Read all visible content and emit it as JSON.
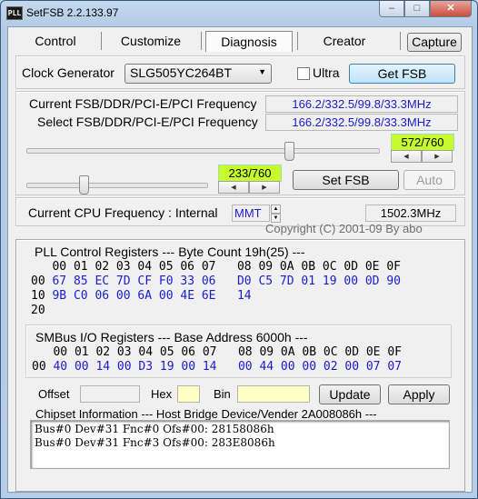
{
  "window": {
    "title": "SetFSB 2.2.133.97",
    "icon_text": "PLL"
  },
  "tabs": [
    {
      "label": "Control"
    },
    {
      "label": "Customize"
    },
    {
      "label": "Diagnosis"
    },
    {
      "label": "Creator"
    }
  ],
  "capture_button": "Capture",
  "clock_generator": {
    "label": "Clock Generator",
    "value": "SLG505YC264BT",
    "ultra_label": "Ultra",
    "ultra_checked": false,
    "get_fsb_button": "Get FSB"
  },
  "freq": {
    "current_label": "Current FSB/DDR/PCI-E/PCI Frequency",
    "current_value": "166.2/332.5/99.8/33.3MHz",
    "select_label": "Select FSB/DDR/PCI-E/PCI Frequency",
    "select_value": "166.2/332.5/99.8/33.3MHz"
  },
  "slider_main": {
    "readout": "572/760",
    "value": 572,
    "max": 760
  },
  "slider_small": {
    "readout": "233/760",
    "value": 233,
    "max": 760
  },
  "set_fsb_button": "Set FSB",
  "auto_button": "Auto",
  "cpu": {
    "label": "Current CPU Frequency : Internal",
    "mode": "MMT",
    "value": "1502.3MHz"
  },
  "copyright": "Copyright (C) 2001-09 By abo",
  "pll": {
    "title": "PLL Control Registers  --- Byte Count 19h(25) ---",
    "header": "   00 01 02 03 04 05 06 07   08 09 0A 0B 0C 0D 0E 0F",
    "rows": [
      {
        "idx": "00",
        "data": " 67 85 EC 7D CF F0 33 06   D0 C5 7D 01 19 00 0D 90"
      },
      {
        "idx": "10",
        "data": " 9B C0 06 00 6A 00 4E 6E   14"
      },
      {
        "idx": "20",
        "data": ""
      }
    ]
  },
  "smbus": {
    "title": "SMBus I/O Registers  --- Base Address 6000h ---",
    "header": "   00 01 02 03 04 05 06 07   08 09 0A 0B 0C 0D 0E 0F",
    "rows": [
      {
        "idx": "00",
        "data": " 40 00 14 00 D3 19 00 14   00 44 00 00 02 00 07 07"
      }
    ]
  },
  "io": {
    "offset_label": "Offset",
    "hex_label": "Hex",
    "bin_label": "Bin",
    "update_button": "Update",
    "apply_button": "Apply"
  },
  "chipset": {
    "title": "Chipset Information  --- Host Bridge Device/Vender 2A008086h ---",
    "lines": [
      "Bus#0 Dev#31 Fnc#0 Ofs#00: 28158086h",
      "Bus#0 Dev#31 Fnc#3 Ofs#00: 283E8086h"
    ]
  },
  "colors": {
    "accent_blue": "#1b1bd0",
    "readout_green": "#c8fb2c",
    "field_yellow": "#ffffc4"
  }
}
